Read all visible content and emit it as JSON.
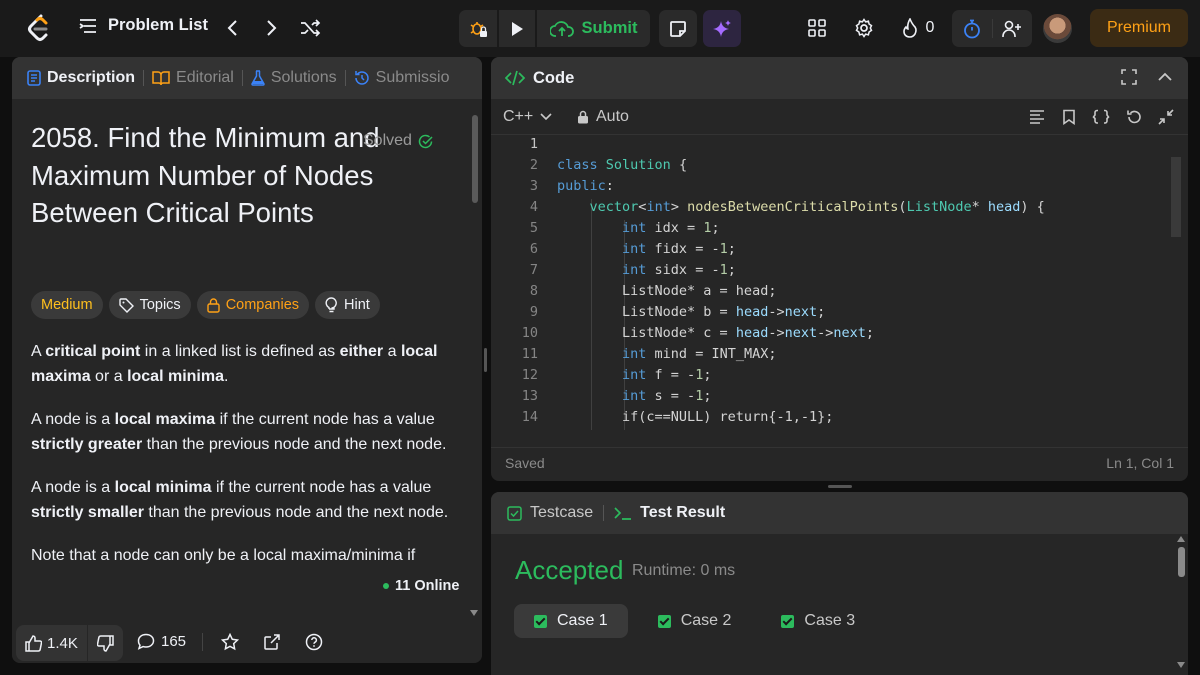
{
  "nav": {
    "problem_list": "Problem List",
    "submit": "Submit",
    "streak": "0",
    "premium": "Premium"
  },
  "left": {
    "tabs": [
      {
        "label": "Description",
        "icon": "description-icon"
      },
      {
        "label": "Editorial",
        "icon": "book-icon"
      },
      {
        "label": "Solutions",
        "icon": "flask-icon"
      },
      {
        "label": "Submissio",
        "icon": "history-icon"
      }
    ],
    "title": "2058. Find the Minimum and Maximum Number of Nodes Between Critical Points",
    "solved": "Solved",
    "tags": {
      "difficulty": "Medium",
      "topics": "Topics",
      "companies": "Companies",
      "hint": "Hint"
    },
    "description": {
      "p1": [
        {
          "text": "A ",
          "bold": false
        },
        {
          "text": "critical point",
          "bold": true
        },
        {
          "text": " in a linked list is defined as ",
          "bold": false
        },
        {
          "text": "either",
          "bold": true
        },
        {
          "text": " a ",
          "bold": false
        },
        {
          "text": "local maxima",
          "bold": true
        },
        {
          "text": " or a ",
          "bold": false
        },
        {
          "text": "local minima",
          "bold": true
        },
        {
          "text": ".",
          "bold": false
        }
      ],
      "p2": [
        {
          "text": "A node is a ",
          "bold": false
        },
        {
          "text": "local maxima",
          "bold": true
        },
        {
          "text": " if the current node has a value ",
          "bold": false
        },
        {
          "text": "strictly greater",
          "bold": true
        },
        {
          "text": " than the previous node and the next node.",
          "bold": false
        }
      ],
      "p3": [
        {
          "text": "A node is a ",
          "bold": false
        },
        {
          "text": "local minima",
          "bold": true
        },
        {
          "text": " if the current node has a value ",
          "bold": false
        },
        {
          "text": "strictly smaller",
          "bold": true
        },
        {
          "text": " than the previous node and the next node.",
          "bold": false
        }
      ],
      "p4": [
        {
          "text": "Note that a node can only be a local maxima/minima if",
          "bold": false
        }
      ]
    },
    "footer": {
      "likes": "1.4K",
      "comments": "165",
      "online": "11 Online"
    }
  },
  "code": {
    "title": "Code",
    "language": "C++",
    "mode": "Auto",
    "status": "Saved",
    "cursor": "Ln 1, Col 1",
    "lines": [
      {
        "n": "1",
        "tokens": []
      },
      {
        "n": "2",
        "tokens": [
          [
            "k",
            "class"
          ],
          [
            "p",
            " "
          ],
          [
            "t",
            "Solution"
          ],
          [
            "p",
            " {"
          ]
        ]
      },
      {
        "n": "3",
        "tokens": [
          [
            "k",
            "public"
          ],
          [
            "p",
            ":"
          ]
        ]
      },
      {
        "n": "4",
        "tokens": [
          [
            "p",
            "    "
          ],
          [
            "t",
            "vector"
          ],
          [
            "p",
            "<"
          ],
          [
            "k",
            "int"
          ],
          [
            "p",
            "> "
          ],
          [
            "f",
            "nodesBetweenCriticalPoints"
          ],
          [
            "p",
            "("
          ],
          [
            "t",
            "ListNode"
          ],
          [
            "p",
            "* "
          ],
          [
            "v",
            "head"
          ],
          [
            "p",
            ") {"
          ]
        ]
      },
      {
        "n": "5",
        "tokens": [
          [
            "p",
            "        "
          ],
          [
            "k",
            "int"
          ],
          [
            "p",
            " idx = "
          ],
          [
            "n",
            "1"
          ],
          [
            "p",
            ";"
          ]
        ]
      },
      {
        "n": "6",
        "tokens": [
          [
            "p",
            "        "
          ],
          [
            "k",
            "int"
          ],
          [
            "p",
            " fidx = -"
          ],
          [
            "n",
            "1"
          ],
          [
            "p",
            ";"
          ]
        ]
      },
      {
        "n": "7",
        "tokens": [
          [
            "p",
            "        "
          ],
          [
            "k",
            "int"
          ],
          [
            "p",
            " sidx = -"
          ],
          [
            "n",
            "1"
          ],
          [
            "p",
            ";"
          ]
        ]
      },
      {
        "n": "8",
        "tokens": [
          [
            "p",
            "        ListNode* a = head;"
          ]
        ]
      },
      {
        "n": "9",
        "tokens": [
          [
            "p",
            "        ListNode* b = "
          ],
          [
            "v",
            "head"
          ],
          [
            "p",
            "->"
          ],
          [
            "v",
            "next"
          ],
          [
            "p",
            ";"
          ]
        ]
      },
      {
        "n": "10",
        "tokens": [
          [
            "p",
            "        ListNode* c = "
          ],
          [
            "v",
            "head"
          ],
          [
            "p",
            "->"
          ],
          [
            "v",
            "next"
          ],
          [
            "p",
            "->"
          ],
          [
            "v",
            "next"
          ],
          [
            "p",
            ";"
          ]
        ]
      },
      {
        "n": "11",
        "tokens": [
          [
            "p",
            "        "
          ],
          [
            "k",
            "int"
          ],
          [
            "p",
            " mind = INT_MAX;"
          ]
        ]
      },
      {
        "n": "12",
        "tokens": [
          [
            "p",
            "        "
          ],
          [
            "k",
            "int"
          ],
          [
            "p",
            " f = -"
          ],
          [
            "n",
            "1"
          ],
          [
            "p",
            ";"
          ]
        ]
      },
      {
        "n": "13",
        "tokens": [
          [
            "p",
            "        "
          ],
          [
            "k",
            "int"
          ],
          [
            "p",
            " s = -"
          ],
          [
            "n",
            "1"
          ],
          [
            "p",
            ";"
          ]
        ]
      },
      {
        "n": "14",
        "tokens": [
          [
            "p",
            "        if(c==NULL) return{-1,-1};"
          ]
        ]
      }
    ]
  },
  "result": {
    "tabs": [
      {
        "label": "Testcase",
        "icon": "checkbox-icon"
      },
      {
        "label": "Test Result",
        "icon": "terminal-icon"
      }
    ],
    "verdict": "Accepted",
    "runtime": "Runtime: 0 ms",
    "cases": [
      "Case 1",
      "Case 2",
      "Case 3"
    ]
  },
  "colors": {
    "accent": "#ffa116",
    "success": "#2cbb5d",
    "panel": "#262626",
    "background": "#0f0f0f"
  }
}
